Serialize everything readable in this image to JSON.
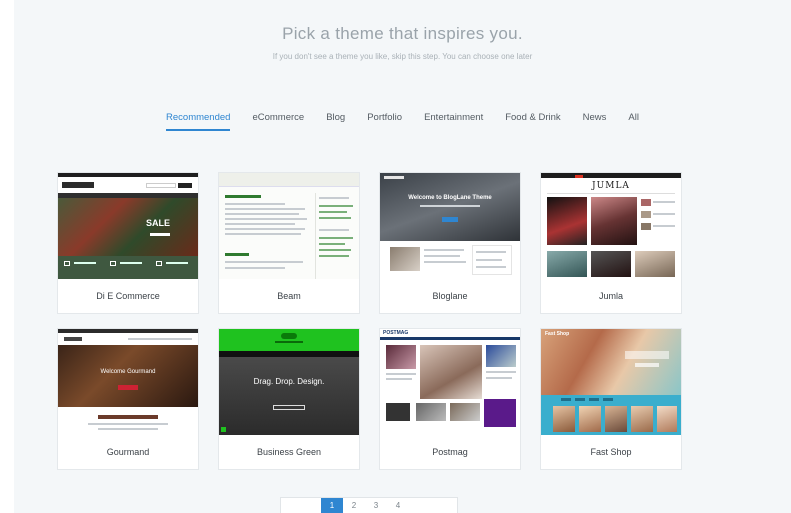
{
  "header": {
    "title": "Pick a theme that inspires you.",
    "subtitle": "If you don't see a theme you like, skip this step. You can choose one later"
  },
  "tabs": [
    {
      "label": "Recommended",
      "active": true
    },
    {
      "label": "eCommerce"
    },
    {
      "label": "Blog"
    },
    {
      "label": "Portfolio"
    },
    {
      "label": "Entertainment"
    },
    {
      "label": "Food & Drink"
    },
    {
      "label": "News"
    },
    {
      "label": "All"
    }
  ],
  "themes": [
    {
      "name": "Di E Commerce",
      "preview_title": "SALE"
    },
    {
      "name": "Beam"
    },
    {
      "name": "Bloglane",
      "preview_title": "Welcome to BlogLane Theme"
    },
    {
      "name": "Jumla",
      "preview_title": "JUMLA"
    },
    {
      "name": "Gourmand",
      "preview_title": "Welcome Gourmand"
    },
    {
      "name": "Business Green",
      "preview_title": "Drag. Drop. Design."
    },
    {
      "name": "Postmag",
      "preview_title": "POSTMAG"
    },
    {
      "name": "Fast Shop",
      "preview_title": "Fast Shop"
    }
  ],
  "pagination": {
    "pages": [
      "1",
      "2",
      "3",
      "4"
    ],
    "current": "1"
  },
  "colors": {
    "accent": "#2f86d1",
    "background": "#f4f7f9"
  }
}
